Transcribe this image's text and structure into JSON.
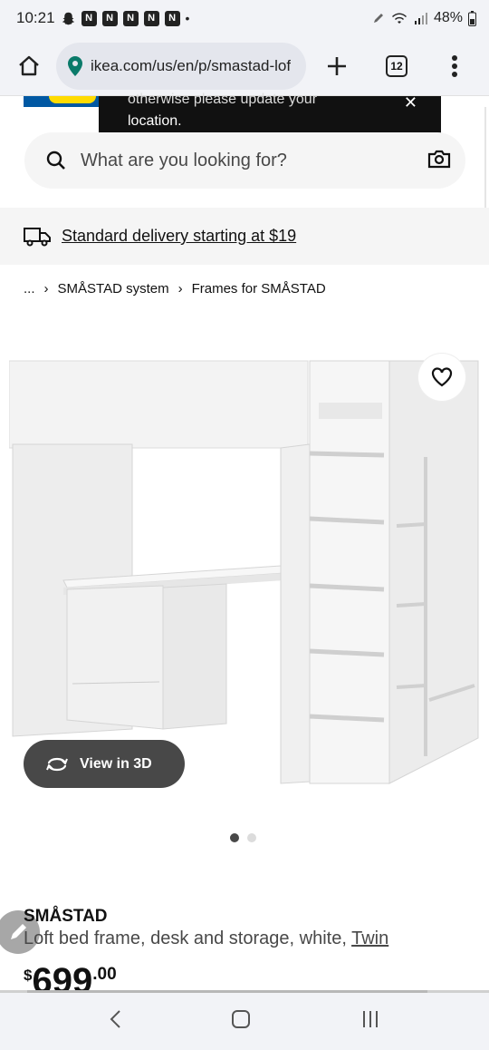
{
  "status_bar": {
    "time": "10:21",
    "notif_letter": "N",
    "dot": "•",
    "battery": "48%"
  },
  "browser": {
    "url": "ikea.com/us/en/p/smastad-lof",
    "tab_count": "12"
  },
  "toast": {
    "line1": "otherwise please update your",
    "line2": "location.",
    "close": "✕"
  },
  "search": {
    "placeholder": "What are you looking for?"
  },
  "delivery": {
    "text": "Standard delivery starting at $19"
  },
  "breadcrumb": {
    "ellipsis": "...",
    "sep": "›",
    "items": [
      "SMÅSTAD system",
      "Frames for SMÅSTAD"
    ]
  },
  "product": {
    "view3d_label": "View in 3D",
    "name": "SMÅSTAD",
    "description": "Loft bed frame, desk and storage, white, ",
    "size_link": "Twin",
    "price_currency": "$",
    "price_int": "699",
    "price_dec": ".00",
    "image_count": 2,
    "active_image": 1
  },
  "colors": {
    "ikea_blue": "#0058a3",
    "ikea_yellow": "#ffdb00",
    "dark_button": "#484848"
  }
}
